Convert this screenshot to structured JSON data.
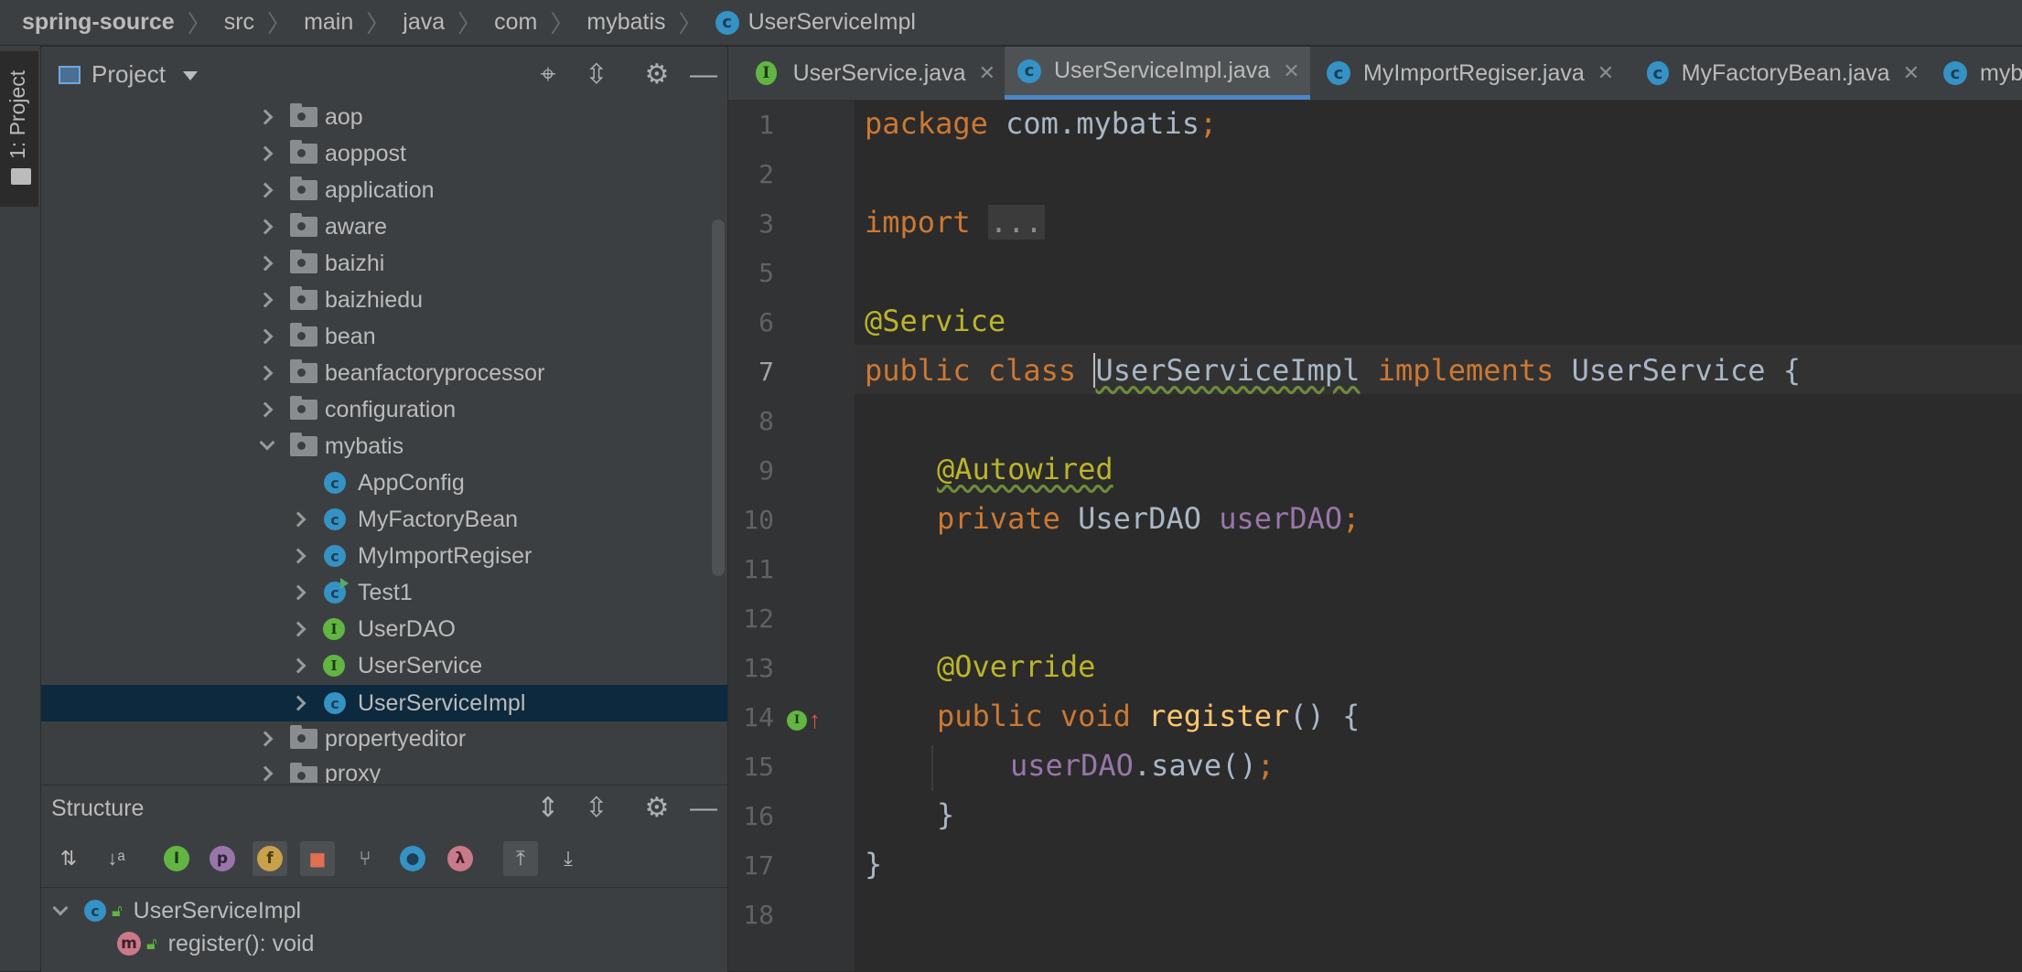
{
  "breadcrumb": [
    "spring-source",
    "src",
    "main",
    "java",
    "com",
    "mybatis",
    "UserServiceImpl"
  ],
  "sidebar_strip": {
    "label": "1: Project"
  },
  "project_panel": {
    "title": "Project",
    "tree": [
      {
        "label": "aop",
        "type": "folder",
        "state": "collapsed",
        "level": 0
      },
      {
        "label": "aoppost",
        "type": "folder",
        "state": "collapsed",
        "level": 0
      },
      {
        "label": "application",
        "type": "folder",
        "state": "collapsed",
        "level": 0
      },
      {
        "label": "aware",
        "type": "folder",
        "state": "collapsed",
        "level": 0
      },
      {
        "label": "baizhi",
        "type": "folder",
        "state": "collapsed",
        "level": 0
      },
      {
        "label": "baizhiedu",
        "type": "folder",
        "state": "collapsed",
        "level": 0
      },
      {
        "label": "bean",
        "type": "folder",
        "state": "collapsed",
        "level": 0
      },
      {
        "label": "beanfactoryprocessor",
        "type": "folder",
        "state": "collapsed",
        "level": 0
      },
      {
        "label": "configuration",
        "type": "folder",
        "state": "collapsed",
        "level": 0
      },
      {
        "label": "mybatis",
        "type": "folder",
        "state": "expanded",
        "level": 0
      },
      {
        "label": "AppConfig",
        "type": "class",
        "state": "leaf",
        "level": 1
      },
      {
        "label": "MyFactoryBean",
        "type": "class",
        "state": "collapsed",
        "level": 1
      },
      {
        "label": "MyImportRegiser",
        "type": "class",
        "state": "collapsed",
        "level": 1
      },
      {
        "label": "Test1",
        "type": "class-runnable",
        "state": "collapsed",
        "level": 1
      },
      {
        "label": "UserDAO",
        "type": "interface",
        "state": "collapsed",
        "level": 1
      },
      {
        "label": "UserService",
        "type": "interface",
        "state": "collapsed",
        "level": 1
      },
      {
        "label": "UserServiceImpl",
        "type": "class",
        "state": "collapsed",
        "level": 1,
        "selected": true
      },
      {
        "label": "propertyeditor",
        "type": "folder",
        "state": "collapsed",
        "level": 0
      },
      {
        "label": "proxy",
        "type": "folder",
        "state": "collapsed",
        "level": 0
      }
    ]
  },
  "structure_panel": {
    "title": "Structure",
    "items": [
      {
        "label": "UserServiceImpl",
        "kind": "class"
      },
      {
        "label": "register(): void",
        "kind": "method"
      }
    ]
  },
  "tabs": [
    {
      "label": "UserService.java",
      "kind": "interface",
      "active": false
    },
    {
      "label": "UserServiceImpl.java",
      "kind": "class",
      "active": true
    },
    {
      "label": "MyImportRegiser.java",
      "kind": "class",
      "active": false
    },
    {
      "label": "MyFactoryBean.java",
      "kind": "class",
      "active": false
    },
    {
      "label": "myb",
      "kind": "class",
      "active": false
    }
  ],
  "editor": {
    "line_numbers": [
      "1",
      "2",
      "3",
      "5",
      "6",
      "7",
      "8",
      "9",
      "10",
      "11",
      "12",
      "13",
      "14",
      "15",
      "16",
      "17",
      "18"
    ],
    "current_line": "7",
    "code": {
      "l1_kw": "package",
      "l1_rest": " com.mybatis",
      "l1_semi": ";",
      "l3_kw": "import",
      "l3_fold": "...",
      "l6_ann": "@Service",
      "l7_kw": "public class",
      "l7_cls": "UserServiceImpl",
      "l7_kw2": "implements",
      "l7_rest": " UserService {",
      "l9_ann": "@Autowired",
      "l10_kw": "private",
      "l10_type": " UserDAO ",
      "l10_fld": "userDAO",
      "l10_semi": ";",
      "l13_ann": "@Override",
      "l14_kw": "public void",
      "l14_mth": "register",
      "l14_rest": "() {",
      "l15_fld": "userDAO",
      "l15_rest": ".save()",
      "l15_semi": ";",
      "l16": "}",
      "l17": "}"
    }
  },
  "colors": {
    "keyword": "#cc7832",
    "annotation": "#bbb529",
    "field": "#9876aa",
    "method": "#ffc66d",
    "text": "#a9b7c6",
    "selection": "#0d293e",
    "accent": "#4a88c7"
  }
}
